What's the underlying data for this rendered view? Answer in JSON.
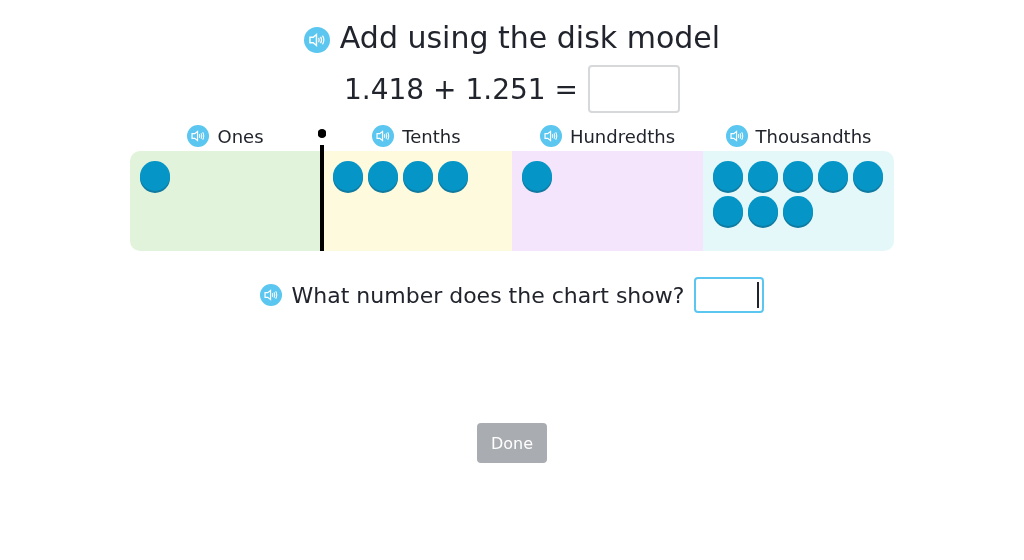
{
  "title": "Add using the disk model",
  "equation": {
    "text": "1.418 + 1.251 =",
    "answer": {
      "focused": false
    }
  },
  "place_columns": [
    {
      "label": "Ones",
      "color": "#e1f3da",
      "disks": [
        {
          "kind": "disk"
        }
      ]
    },
    {
      "label": "Tenths",
      "color": "#fefadd",
      "disks": [
        {
          "kind": "disk"
        },
        {
          "kind": "disk"
        },
        {
          "kind": "disk"
        },
        {
          "kind": "disk"
        }
      ]
    },
    {
      "label": "Hundredths",
      "color": "#f4e5fd",
      "disks": [
        {
          "kind": "disk"
        }
      ]
    },
    {
      "label": "Thousandths",
      "color": "#e4f7f9",
      "disks": [
        {
          "kind": "disk"
        },
        {
          "kind": "disk"
        },
        {
          "kind": "disk"
        },
        {
          "kind": "disk"
        },
        {
          "kind": "disk"
        },
        {
          "kind": "disk"
        },
        {
          "kind": "disk"
        },
        {
          "kind": "disk"
        }
      ]
    }
  ],
  "question": {
    "text": "What number does the chart show?",
    "answer": {
      "focused": true
    }
  },
  "done_button": {
    "label": "Done",
    "disabled": true
  }
}
